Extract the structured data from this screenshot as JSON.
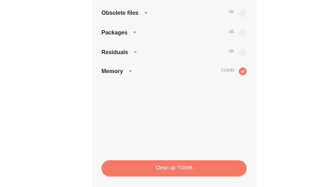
{
  "items": [
    {
      "label": "Obsolete files",
      "size": "0B",
      "checked": false
    },
    {
      "label": "Packages",
      "size": "0B",
      "checked": false
    },
    {
      "label": "Residuals",
      "size": "0B",
      "checked": false
    },
    {
      "label": "Memory",
      "size": "710MB",
      "checked": true
    }
  ],
  "cleanup_button": {
    "label": "Clean up 710MB"
  },
  "colors": {
    "accent": "#f47a67",
    "unchecked": "#efefef",
    "panel_bg": "#f7f7f7"
  }
}
